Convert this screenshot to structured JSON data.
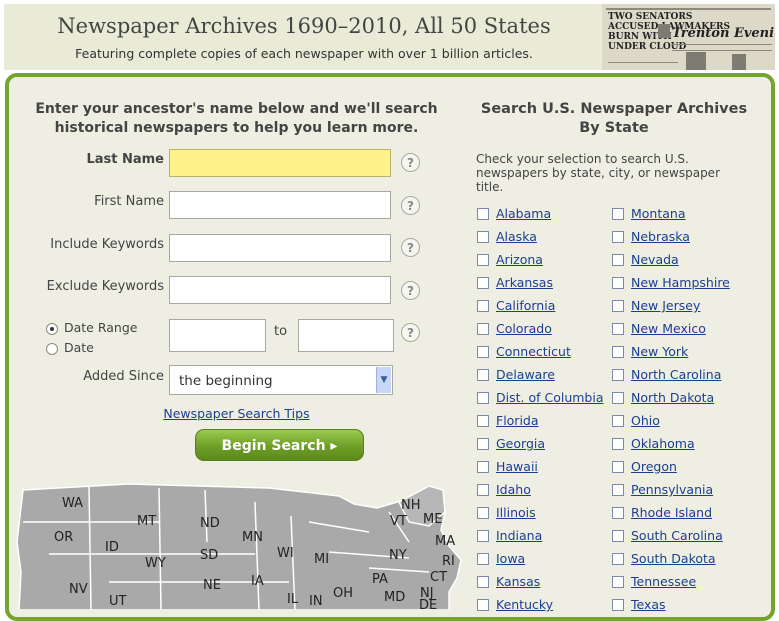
{
  "header": {
    "title": "Newspaper Archives 1690–2010, All 50 States",
    "subtitle": "Featuring complete copies of each newspaper with over 1 billion articles.",
    "newspaper_image": {
      "headline_small": "TWO SENATORS\nACCUSED LAWMAKERS\nBURN WITH\nUNDER CLOUD",
      "masthead": "Trenton Evening Times"
    }
  },
  "search": {
    "intro": "Enter your ancestor's name below and we'll search historical newspapers to help you learn more.",
    "last_name_label": "Last Name",
    "first_name_label": "First Name",
    "include_keywords_label": "Include Keywords",
    "exclude_keywords_label": "Exclude Keywords",
    "date_range_label": "Date Range",
    "date_label": "Date",
    "to_label": "to",
    "added_since_label": "Added Since",
    "added_since_value": "the beginning",
    "help_glyph": "?",
    "tips_link": "Newspaper Search Tips",
    "begin_button": "Begin Search ▸"
  },
  "map": {
    "states": [
      "WA",
      "NH",
      "VT",
      "ME",
      "MT",
      "ND",
      "MN",
      "MA",
      "OR",
      "ID",
      "WY",
      "SD",
      "WI",
      "MI",
      "NY",
      "RI",
      "CT",
      "NV",
      "NE",
      "IA",
      "PA",
      "NJ",
      "UT",
      "IL",
      "IN",
      "OH",
      "MD",
      "DE"
    ]
  },
  "states_panel": {
    "title": "Search U.S. Newspaper Archives By State",
    "description": "Check your selection to search U.S. newspapers by state, city, or newspaper title.",
    "column_a": [
      "Alabama",
      "Alaska",
      "Arizona",
      "Arkansas",
      "California",
      "Colorado",
      "Connecticut",
      "Delaware",
      "Dist. of Columbia",
      "Florida",
      "Georgia",
      "Hawaii",
      "Idaho",
      "Illinois",
      "Indiana",
      "Iowa",
      "Kansas",
      "Kentucky"
    ],
    "column_b": [
      "Montana",
      "Nebraska",
      "Nevada",
      "New Hampshire",
      "New Jersey",
      "New Mexico",
      "New York",
      "North Carolina",
      "North Dakota",
      "Ohio",
      "Oklahoma",
      "Oregon",
      "Pennsylvania",
      "Rhode Island",
      "South Carolina",
      "South Dakota",
      "Tennessee",
      "Texas"
    ]
  },
  "colors": {
    "frame_green": "#75a32b",
    "highlight_input": "#fff28a",
    "link_blue": "#1b3f8f",
    "panel_bg": "#eeeee3"
  }
}
